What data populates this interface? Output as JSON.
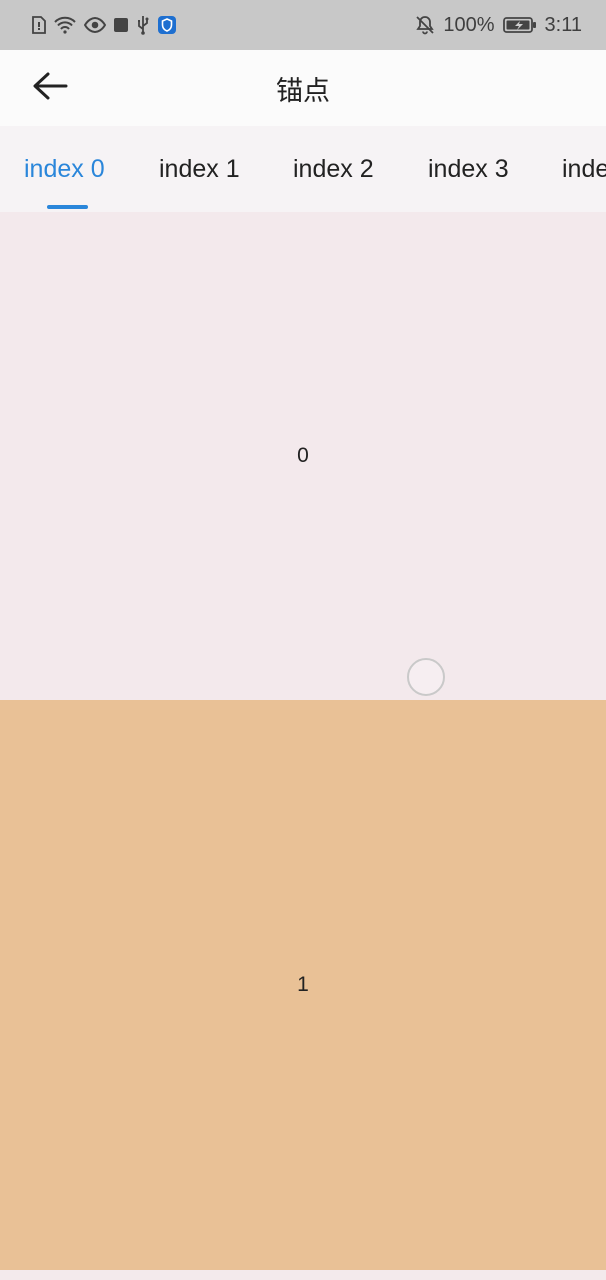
{
  "status_bar": {
    "battery_percent": "100%",
    "time": "3:11",
    "left_icons": [
      "sim-card-icon",
      "wifi-icon",
      "eye-icon",
      "square-icon",
      "usb-icon",
      "shield-icon"
    ],
    "right_icons": [
      "bell-off-icon",
      "battery-charging-icon"
    ]
  },
  "app_bar": {
    "title": "锚点",
    "back_icon": "arrow-left-icon"
  },
  "tabs": [
    {
      "label": "index 0",
      "active": true
    },
    {
      "label": "index 1",
      "active": false
    },
    {
      "label": "index 2",
      "active": false
    },
    {
      "label": "index 3",
      "active": false
    },
    {
      "label": "inde",
      "active": false
    }
  ],
  "panels": [
    {
      "label": "0",
      "color": "#f3e9ec"
    },
    {
      "label": "1",
      "color": "#e9c196"
    }
  ],
  "colors": {
    "accent": "#2a86da",
    "status_bar_bg": "#c8c8c8",
    "app_bar_bg": "#fbfbfb"
  }
}
